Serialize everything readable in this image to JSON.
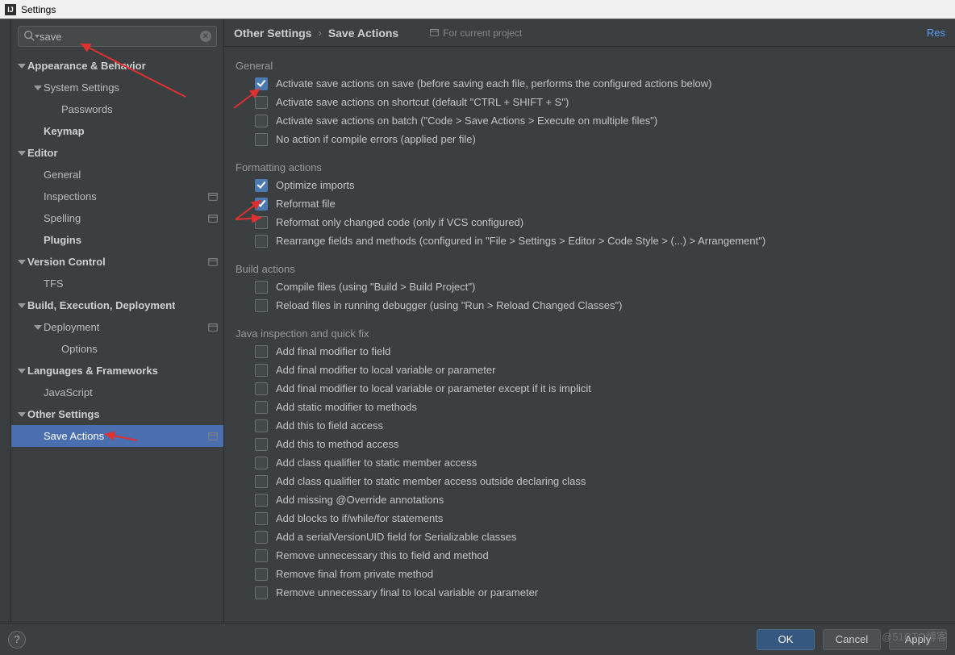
{
  "window": {
    "title": "Settings"
  },
  "search": {
    "value": "save"
  },
  "sidebar": {
    "items": [
      {
        "label": "Appearance & Behavior",
        "indent": 0,
        "bold": true,
        "arrow": "down",
        "trail": false
      },
      {
        "label": "System Settings",
        "indent": 1,
        "bold": false,
        "arrow": "down",
        "trail": false
      },
      {
        "label": "Passwords",
        "indent": 2,
        "bold": false,
        "arrow": "",
        "trail": false
      },
      {
        "label": "Keymap",
        "indent": 1,
        "bold": true,
        "arrow": "",
        "trail": false
      },
      {
        "label": "Editor",
        "indent": 0,
        "bold": true,
        "arrow": "down",
        "trail": false
      },
      {
        "label": "General",
        "indent": 1,
        "bold": false,
        "arrow": "",
        "trail": false
      },
      {
        "label": "Inspections",
        "indent": 1,
        "bold": false,
        "arrow": "",
        "trail": true
      },
      {
        "label": "Spelling",
        "indent": 1,
        "bold": false,
        "arrow": "",
        "trail": true
      },
      {
        "label": "Plugins",
        "indent": 1,
        "bold": true,
        "arrow": "",
        "trail": false
      },
      {
        "label": "Version Control",
        "indent": 0,
        "bold": true,
        "arrow": "down",
        "trail": true
      },
      {
        "label": "TFS",
        "indent": 1,
        "bold": false,
        "arrow": "",
        "trail": false
      },
      {
        "label": "Build, Execution, Deployment",
        "indent": 0,
        "bold": true,
        "arrow": "down",
        "trail": false
      },
      {
        "label": "Deployment",
        "indent": 1,
        "bold": false,
        "arrow": "down",
        "trail": true
      },
      {
        "label": "Options",
        "indent": 2,
        "bold": false,
        "arrow": "",
        "trail": false
      },
      {
        "label": "Languages & Frameworks",
        "indent": 0,
        "bold": true,
        "arrow": "down",
        "trail": false
      },
      {
        "label": "JavaScript",
        "indent": 1,
        "bold": false,
        "arrow": "",
        "trail": false
      },
      {
        "label": "Other Settings",
        "indent": 0,
        "bold": true,
        "arrow": "down",
        "trail": false
      },
      {
        "label": "Save Actions",
        "indent": 1,
        "bold": false,
        "arrow": "",
        "trail": true,
        "selected": true
      }
    ]
  },
  "breadcrumb": {
    "root": "Other Settings",
    "leaf": "Save Actions",
    "scope": "For current project",
    "reset": "Res"
  },
  "sections": [
    {
      "title": "General",
      "items": [
        {
          "label": "Activate save actions on save (before saving each file, performs the configured actions below)",
          "checked": true
        },
        {
          "label": "Activate save actions on shortcut (default \"CTRL + SHIFT + S\")",
          "checked": false
        },
        {
          "label": "Activate save actions on batch (\"Code > Save Actions > Execute on multiple files\")",
          "checked": false
        },
        {
          "label": "No action if compile errors (applied per file)",
          "checked": false
        }
      ]
    },
    {
      "title": "Formatting actions",
      "items": [
        {
          "label": "Optimize imports",
          "checked": true
        },
        {
          "label": "Reformat file",
          "checked": true
        },
        {
          "label": "Reformat only changed code (only if VCS configured)",
          "checked": false
        },
        {
          "label": "Rearrange fields and methods (configured in \"File > Settings > Editor > Code Style > (...) > Arrangement\")",
          "checked": false
        }
      ]
    },
    {
      "title": "Build actions",
      "items": [
        {
          "label": "Compile files (using \"Build > Build Project\")",
          "checked": false
        },
        {
          "label": "Reload files in running debugger (using \"Run > Reload Changed Classes\")",
          "checked": false
        }
      ]
    },
    {
      "title": "Java inspection and quick fix",
      "items": [
        {
          "label": "Add final modifier to field",
          "checked": false
        },
        {
          "label": "Add final modifier to local variable or parameter",
          "checked": false
        },
        {
          "label": "Add final modifier to local variable or parameter except if it is implicit",
          "checked": false
        },
        {
          "label": "Add static modifier to methods",
          "checked": false
        },
        {
          "label": "Add this to field access",
          "checked": false
        },
        {
          "label": "Add this to method access",
          "checked": false
        },
        {
          "label": "Add class qualifier to static member access",
          "checked": false
        },
        {
          "label": "Add class qualifier to static member access outside declaring class",
          "checked": false
        },
        {
          "label": "Add missing @Override annotations",
          "checked": false
        },
        {
          "label": "Add blocks to if/while/for statements",
          "checked": false
        },
        {
          "label": "Add a serialVersionUID field for Serializable classes",
          "checked": false
        },
        {
          "label": "Remove unnecessary this to field and method",
          "checked": false
        },
        {
          "label": "Remove final from private method",
          "checked": false
        },
        {
          "label": "Remove unnecessary final to local variable or parameter",
          "checked": false
        }
      ]
    }
  ],
  "footer": {
    "ok": "OK",
    "cancel": "Cancel",
    "apply": "Apply",
    "help": "?"
  },
  "watermark": "@51CTO博客"
}
